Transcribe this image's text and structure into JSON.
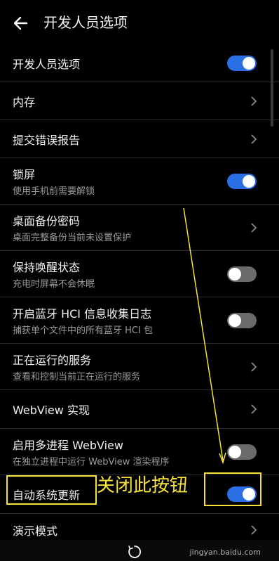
{
  "header": {
    "title": "开发人员选项",
    "back_icon": "arrow-left-icon"
  },
  "items": [
    {
      "label": "开发人员选项",
      "control": "toggle",
      "state": "on"
    },
    {
      "label": "内存",
      "control": "chevron"
    },
    {
      "label": "提交错误报告",
      "control": "chevron"
    },
    {
      "label": "锁屏",
      "sub": "使用手机前需要解锁",
      "control": "toggle",
      "state": "on"
    },
    {
      "label": "桌面备份密码",
      "sub": "桌面完整备份当前未设置保护",
      "control": "chevron"
    },
    {
      "label": "保持唤醒状态",
      "sub": "充电时屏幕不会休眠",
      "control": "toggle",
      "state": "off"
    },
    {
      "label": "开启蓝牙 HCI 信息收集日志",
      "sub": "捕获单个文件中的所有蓝牙 HCI 包",
      "control": "toggle",
      "state": "off"
    },
    {
      "label": "正在运行的服务",
      "sub": "查看和控制当前正在运行的服务",
      "control": "chevron"
    },
    {
      "label": "WebView 实现",
      "control": "chevron"
    },
    {
      "label": "启用多进程 WebView",
      "sub": "在独立进程中运行 WebView 渲染程序",
      "control": "toggle",
      "state": "off"
    },
    {
      "label": "自动系统更新",
      "control": "toggle",
      "state": "on"
    },
    {
      "label": "演示模式",
      "control": "chevron"
    }
  ],
  "annotation": {
    "text": "关闭此按钮",
    "color": "#f7e23a"
  },
  "colors": {
    "background": "#000000",
    "toggle_on": "#2a6fe3",
    "toggle_off": "#6a6a6a",
    "highlight": "#f7e23a"
  },
  "navbar": {
    "home_icon": "home-circle-icon"
  },
  "watermark": {
    "text": "jingyan.baidu.com"
  }
}
